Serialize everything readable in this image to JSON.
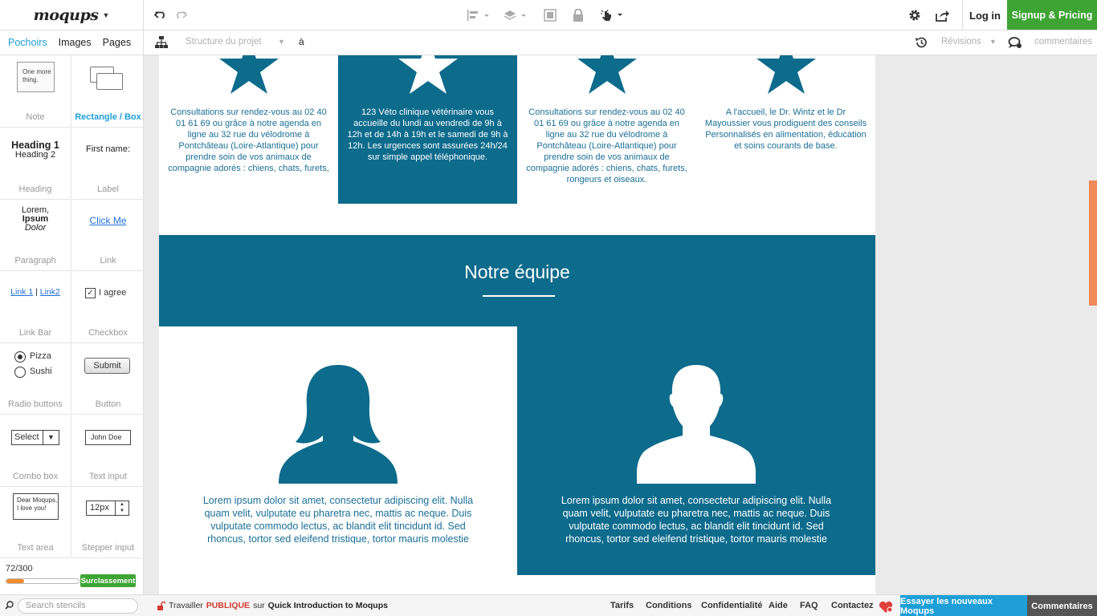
{
  "app": {
    "logo": "moqups"
  },
  "topbar": {
    "login": "Log in",
    "signup": "Signup & Pricing"
  },
  "subbar": {
    "tabs": [
      "Pochoirs",
      "Images",
      "Pages"
    ],
    "structure_placeholder": "Structure du projet",
    "structure_suffix": "à",
    "revisions": "Révisions",
    "comments": "commentaires"
  },
  "stencils": {
    "note": {
      "preview": "One more thing.",
      "label": "Note"
    },
    "rectangle": {
      "label_a": "Rectangle",
      "label_sep": " / ",
      "label_b": "Box"
    },
    "heading": {
      "h1": "Heading 1",
      "h2": "Heading 2",
      "label": "Heading"
    },
    "label": {
      "preview": "First name:",
      "label": "Label"
    },
    "paragraph": {
      "l1": "Lorem,",
      "l2": "Ipsum",
      "l3": "Dolor",
      "label": "Paragraph"
    },
    "link": {
      "preview": "Click Me",
      "label": "Link"
    },
    "linkbar": {
      "link1": "Link 1",
      "sep": "|",
      "link2": "Link2",
      "label": "Link Bar"
    },
    "checkbox": {
      "preview": "I agree",
      "label": "Checkbox"
    },
    "radio": {
      "opt1": "Pizza",
      "opt2": "Sushi",
      "label": "Radio buttons"
    },
    "button": {
      "preview": "Submit",
      "label": "Button"
    },
    "combo": {
      "preview": "Select",
      "label": "Combo box"
    },
    "textinput": {
      "preview": "John Doe",
      "label": "Text input"
    },
    "textarea": {
      "l1": "Dear Moqups,",
      "l2": "I love you!",
      "label": "Text area"
    },
    "stepper": {
      "preview": "12px",
      "label": "Stepper input"
    }
  },
  "quota": {
    "count": "72/300",
    "progress": 0.24,
    "upgrade": "Surclassement"
  },
  "canvas": {
    "services": [
      "Consultations sur rendez-vous au 02 40 01 61 69 ou grâce à notre agenda en ligne au 32 rue du vélodrome à Pontchâteau (Loire-Atlantique) pour prendre soin de vos animaux de compagnie adorés : chiens, chats, furets,",
      "123 Véto clinique vétérinaire vous accueille du lundi au vendredi de 9h à 12h et de 14h à 19h et le samedi de 9h à 12h. Les urgences sont assurées 24h/24 sur simple appel téléphonique.",
      "Consultations sur rendez-vous au 02 40 01 61 69 ou grâce à notre agenda en ligne au 32 rue du vélodrome à Pontchâteau (Loire-Atlantique) pour prendre soin de vos animaux de compagnie adorés : chiens, chats, furets, rongeurs et oiseaux.",
      "A l'accueil, le Dr. Wintz et le Dr Mayoussier vous prodiguent des conseils Personnalisés en alimentation, éducation et soins courants de base."
    ],
    "team_title": "Notre équipe",
    "member_text": "Lorem ipsum dolor sit amet, consectetur adipiscing elit. Nulla quam velit, vulputate eu pharetra nec, mattis ac neque. Duis vulputate commodo lectus, ac blandit elit tincidunt id. Sed rhoncus, tortor sed eleifend tristique, tortor mauris molestie"
  },
  "footer": {
    "search_placeholder": "Search stencils",
    "work_prefix": "Travailler",
    "visibility": "PUBLIQUE",
    "on": "sur",
    "project": "Quick Introduction to Moqups",
    "links": [
      "Tarifs",
      "Conditions",
      "Confidentialité",
      "Aide",
      "FAQ",
      "Contactez"
    ],
    "try_new": "Essayer les nouveaux Moqups",
    "comments": "Commentaires"
  },
  "colors": {
    "teal": "#0d6b8c",
    "green": "#3ea535",
    "blue": "#1e9fd7",
    "orange": "#f28b2a"
  }
}
